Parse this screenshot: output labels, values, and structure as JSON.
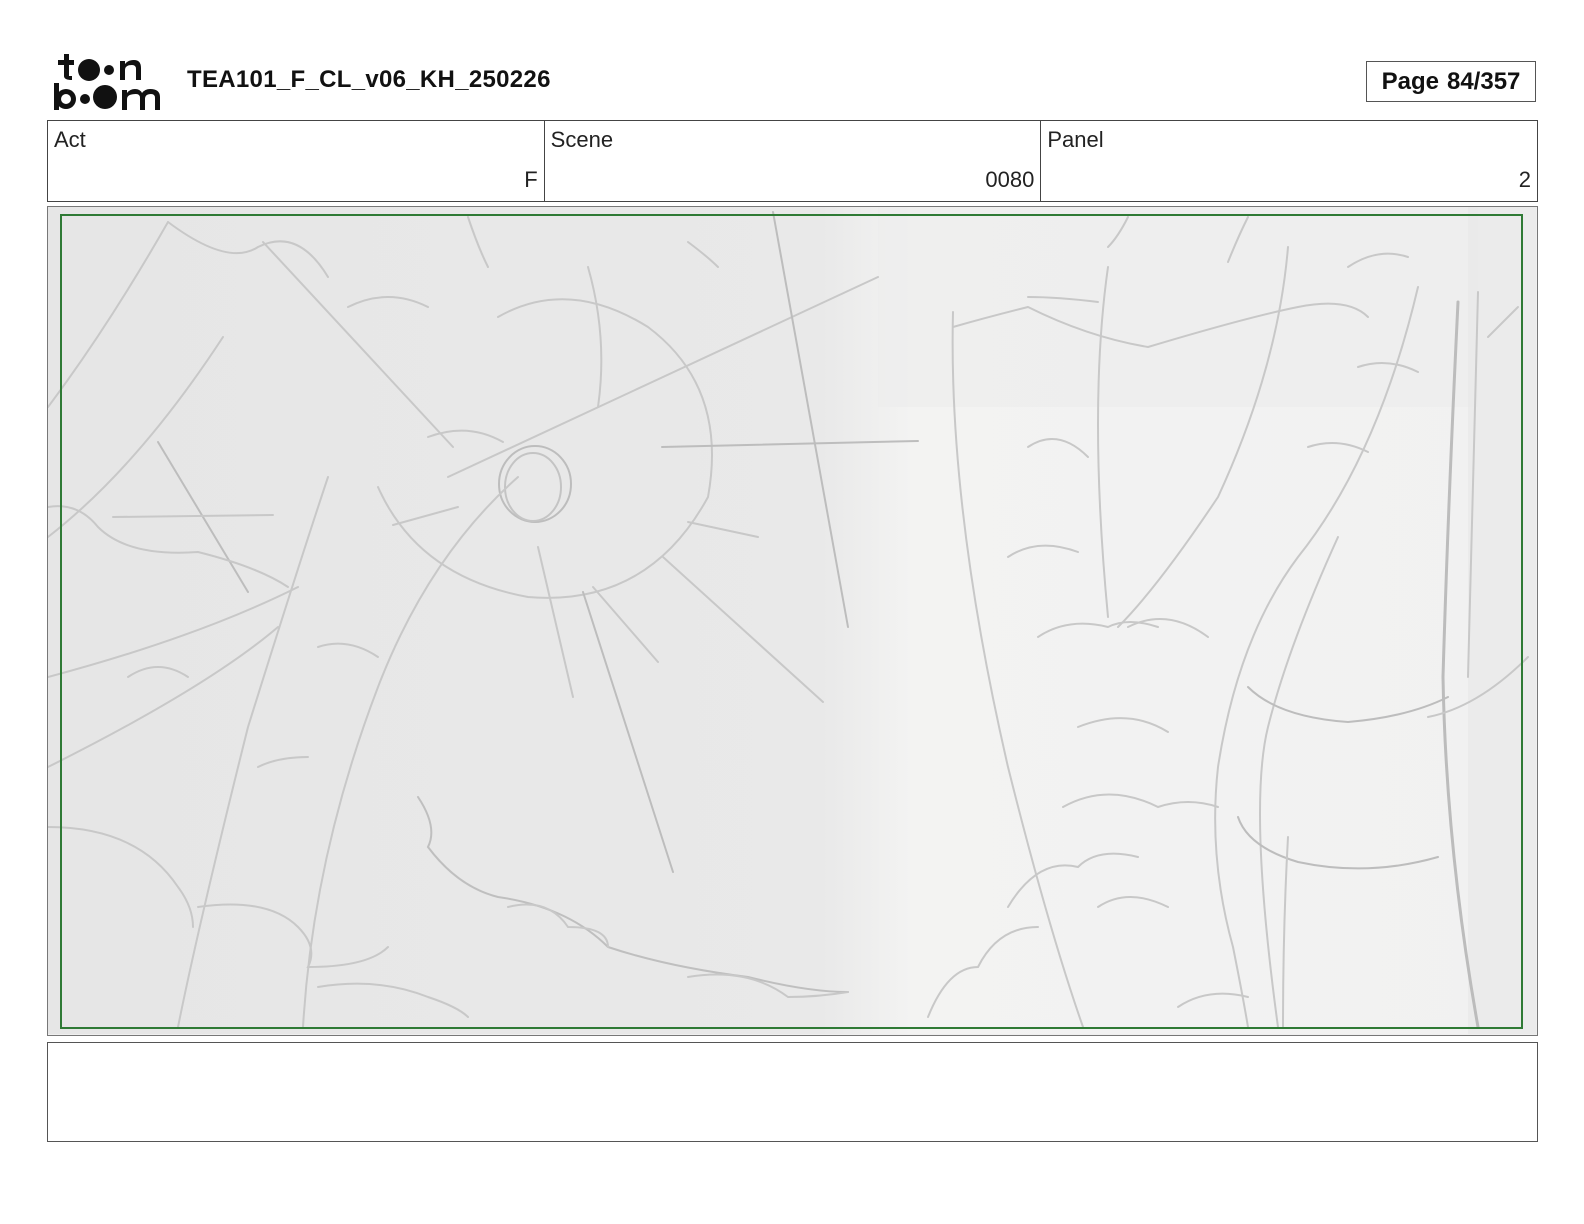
{
  "logo": {
    "text": "toon boom",
    "icon": "toon-boom-logo-icon"
  },
  "header": {
    "title": "TEA101_F_CL_v06_KH_250226",
    "page_label": "Page",
    "page_value": "84/357"
  },
  "info": {
    "act_label": "Act",
    "act_value": "F",
    "scene_label": "Scene",
    "scene_value": "0080",
    "panel_label": "Panel",
    "panel_value": "2"
  },
  "panel": {
    "image": "storyboard-sketch",
    "safe_frame_color": "#2f7a35"
  },
  "notes": {
    "text": ""
  }
}
